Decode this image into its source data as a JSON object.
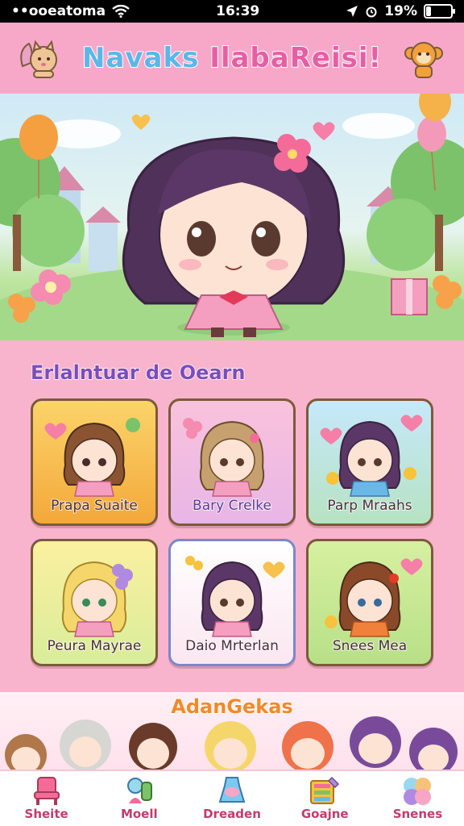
{
  "status_bar": {
    "carrier": "••ooeatoma",
    "time": "16:39",
    "battery": "19%",
    "battery_level": 0.19
  },
  "header": {
    "title_part1": "Navaks",
    "title_part2": "IlabaReisi!"
  },
  "section": {
    "title": "Erlalntuar de Oearn",
    "characters": [
      {
        "name": "Prapa Suaite"
      },
      {
        "name": "Bary Crelke"
      },
      {
        "name": "Parp Mraahs"
      },
      {
        "name": "Peura Mayrae"
      },
      {
        "name": "Daio Mrterlan"
      },
      {
        "name": "Snees Mea"
      }
    ]
  },
  "friends": {
    "title": "AdanGekas"
  },
  "nav": [
    {
      "label": "Sheite",
      "icon": "chair-icon"
    },
    {
      "label": "Moell",
      "icon": "character-icon"
    },
    {
      "label": "Dreaden",
      "icon": "dress-icon"
    },
    {
      "label": "Goajne",
      "icon": "paint-palette-icon"
    },
    {
      "label": "Snenes",
      "icon": "bubbles-icon"
    }
  ],
  "colors": {
    "header_bg": "#f7a8c8",
    "section_bg": "#f8b4cd",
    "accent": "#c23c6e"
  }
}
